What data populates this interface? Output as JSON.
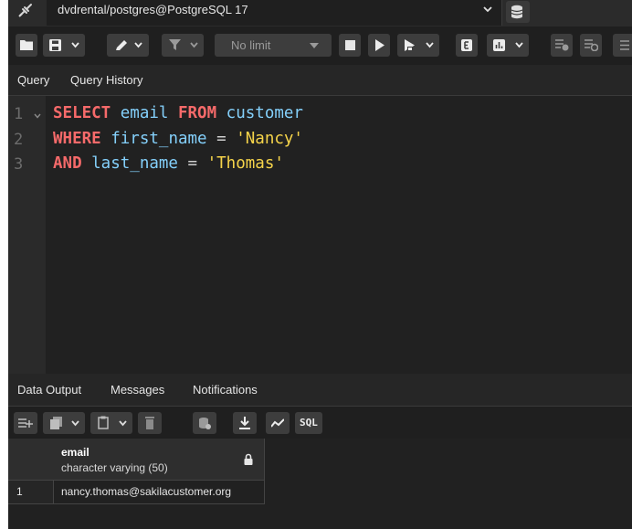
{
  "connection": {
    "label": "dvdrental/postgres@PostgreSQL 17"
  },
  "toolbar": {
    "limit_label": "No limit"
  },
  "query_tabs": [
    {
      "label": "Query"
    },
    {
      "label": "Query History"
    }
  ],
  "editor": {
    "line_numbers": [
      "1",
      "2",
      "3"
    ],
    "lines": [
      [
        {
          "t": "SELECT",
          "c": "kw"
        },
        {
          "t": " email ",
          "c": "id"
        },
        {
          "t": "FROM",
          "c": "kw"
        },
        {
          "t": " customer",
          "c": "id"
        }
      ],
      [
        {
          "t": "WHERE",
          "c": "kw"
        },
        {
          "t": " first_name ",
          "c": "id"
        },
        {
          "t": "=",
          "c": "op"
        },
        {
          "t": " ",
          "c": "id"
        },
        {
          "t": "'Nancy'",
          "c": "str"
        }
      ],
      [
        {
          "t": "AND",
          "c": "kw"
        },
        {
          "t": " last_name ",
          "c": "id"
        },
        {
          "t": "=",
          "c": "op"
        },
        {
          "t": " ",
          "c": "id"
        },
        {
          "t": "'Thomas'",
          "c": "str"
        }
      ]
    ]
  },
  "output_tabs": [
    {
      "label": "Data Output"
    },
    {
      "label": "Messages"
    },
    {
      "label": "Notifications"
    }
  ],
  "output_toolbar": {
    "sql_label": "SQL"
  },
  "results": {
    "columns": [
      {
        "name": "email",
        "type": "character varying (50)"
      }
    ],
    "rows": [
      {
        "number": "1",
        "cells": [
          "nancy.thomas@sakilacustomer.org"
        ]
      }
    ]
  }
}
